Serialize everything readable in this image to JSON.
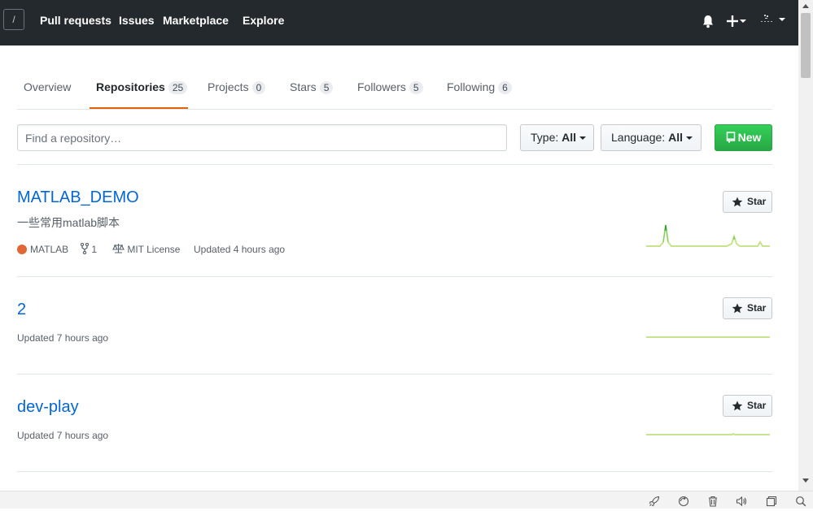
{
  "header": {
    "logo_glyph": "/",
    "nav": [
      "Pull requests",
      "Issues",
      "Marketplace",
      "Explore"
    ],
    "icons": [
      "bell-icon",
      "plus-icon",
      "avatar"
    ]
  },
  "tabs": [
    {
      "label": "Overview",
      "count": null
    },
    {
      "label": "Repositories",
      "count": "25",
      "active": true
    },
    {
      "label": "Projects",
      "count": "0"
    },
    {
      "label": "Stars",
      "count": "5"
    },
    {
      "label": "Followers",
      "count": "5"
    },
    {
      "label": "Following",
      "count": "6"
    }
  ],
  "filters": {
    "search_placeholder": "Find a repository…",
    "type_label": "Type:",
    "type_value": "All",
    "language_label": "Language:",
    "language_value": "All",
    "new_label": "New"
  },
  "repos": [
    {
      "name": "MATLAB_DEMO",
      "description": "一些常用matlab脚本",
      "language": "MATLAB",
      "language_color": "#e16737",
      "forks": "1",
      "license": "MIT License",
      "updated": "Updated 4 hours ago",
      "star_label": "Star"
    },
    {
      "name": "2",
      "updated": "Updated 7 hours ago",
      "star_label": "Star"
    },
    {
      "name": "dev-play",
      "updated": "Updated 7 hours ago",
      "star_label": "Star"
    }
  ],
  "colors": {
    "header_bg": "#24292e",
    "link": "#0366d6",
    "accent_tab": "#e36209",
    "new_button": "#28a745"
  }
}
